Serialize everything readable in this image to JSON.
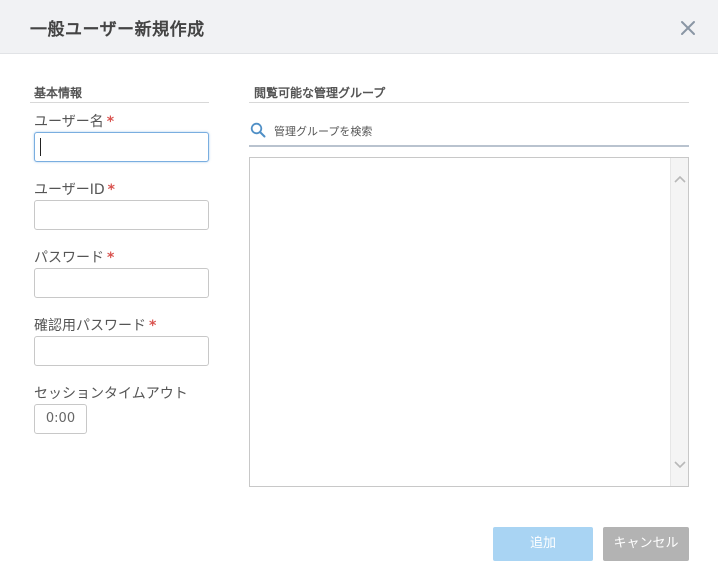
{
  "dialog": {
    "title": "一般ユーザー新規作成"
  },
  "basic_info": {
    "section_title": "基本情報",
    "required_mark": "*",
    "fields": {
      "username": {
        "label": "ユーザー名",
        "value": ""
      },
      "userid": {
        "label": "ユーザーID",
        "value": ""
      },
      "password": {
        "label": "パスワード",
        "value": ""
      },
      "password_confirm": {
        "label": "確認用パスワード",
        "value": ""
      }
    },
    "session_timeout": {
      "label": "セッションタイムアウト",
      "value": "0:00"
    }
  },
  "groups": {
    "section_title": "閲覧可能な管理グループ",
    "search_placeholder": "管理グループを検索",
    "items": []
  },
  "footer": {
    "add_label": "追加",
    "cancel_label": "キャンセル"
  },
  "colors": {
    "add_button": "#a9d4f3",
    "cancel_button": "#b3b3b3",
    "required": "#d9534f"
  }
}
